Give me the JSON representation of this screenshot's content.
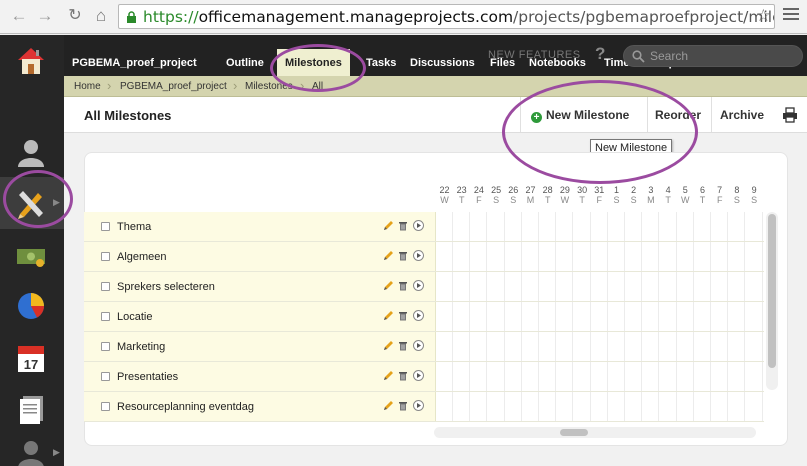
{
  "browser": {
    "url_scheme": "https://",
    "url_host": "officemanagement.manageprojects.com",
    "url_path": "/projects/pgbemaproefproject/mileston"
  },
  "leftbar": {
    "items": [
      {
        "icon": "home-icon"
      },
      {
        "icon": "contacts-icon"
      },
      {
        "icon": "projects-icon",
        "active": true
      },
      {
        "icon": "money-icon"
      },
      {
        "icon": "reports-pie-icon"
      },
      {
        "icon": "calendar-icon",
        "calendar_day": "17"
      },
      {
        "icon": "documents-icon"
      },
      {
        "icon": "user-profile-icon"
      }
    ]
  },
  "topnav": {
    "project_name": "PGBEMA_proef_project",
    "tabs": [
      "Outline",
      "Milestones",
      "Tasks",
      "Discussions",
      "Files",
      "Notebooks",
      "Time and Expenses"
    ],
    "active_tab": "Milestones",
    "new_features": "NEW FEATURES",
    "help": "?",
    "search_placeholder": "Search"
  },
  "breadcrumb": [
    "Home",
    "PGBEMA_proef_project",
    "Milestones",
    "All"
  ],
  "titlebar": {
    "title": "All Milestones",
    "new_milestone": "New Milestone",
    "reorder": "Reorder",
    "archive": "Archive",
    "tooltip": "New Milestone"
  },
  "timeline": {
    "days": [
      "22",
      "23",
      "24",
      "25",
      "26",
      "27",
      "28",
      "29",
      "30",
      "31",
      "1",
      "2",
      "3",
      "4",
      "5",
      "6",
      "7",
      "8",
      "9"
    ],
    "weekdays": [
      "W",
      "T",
      "F",
      "S",
      "S",
      "M",
      "T",
      "W",
      "T",
      "F",
      "S",
      "S",
      "M",
      "T",
      "W",
      "T",
      "F",
      "S",
      "S"
    ]
  },
  "milestones": [
    "Thema",
    "Algemeen",
    "Sprekers selecteren",
    "Locatie",
    "Marketing",
    "Presentaties",
    "Resourceplanning eventdag"
  ],
  "colors": {
    "annotation": "#9b4ba0",
    "accent_green": "#2e9a3a",
    "highlight_row": "#fdfbe3"
  }
}
